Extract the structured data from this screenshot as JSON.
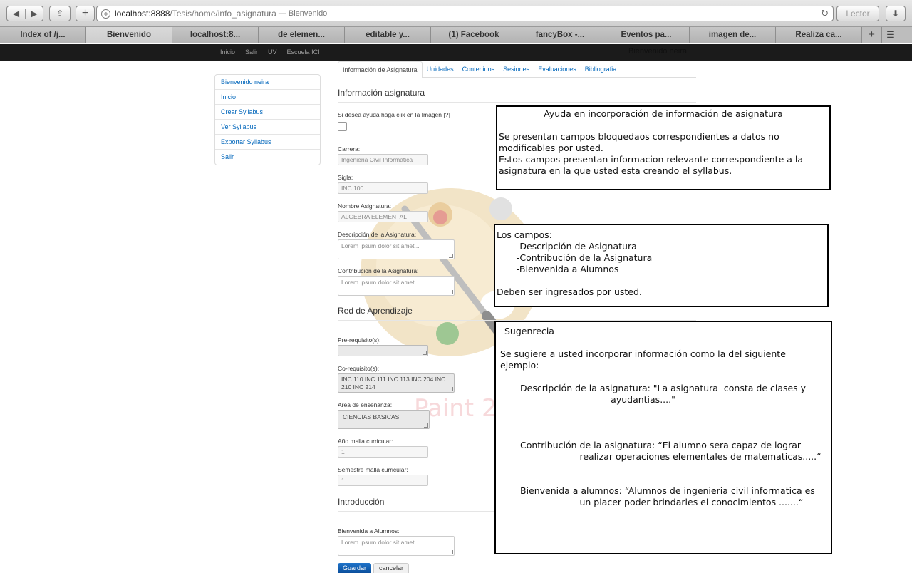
{
  "browser": {
    "url_host": "localhost:8888",
    "url_path": "/Tesis/home/info_asignatura",
    "page_title_sep": "— Bienvenido",
    "reader_label": "Lector",
    "tabs": [
      {
        "label": "Index of /j..."
      },
      {
        "label": "Bienvenido"
      },
      {
        "label": "localhost:8..."
      },
      {
        "label": "de elemen..."
      },
      {
        "label": "editable y..."
      },
      {
        "label": "(1) Facebook"
      },
      {
        "label": "fancyBox -..."
      },
      {
        "label": "Eventos pa..."
      },
      {
        "label": "imagen de..."
      },
      {
        "label": "Realiza ca..."
      }
    ]
  },
  "navbar": {
    "links": [
      "Inicio",
      "Salir",
      "UV",
      "Escuela ICI"
    ],
    "welcome": "Bienvenido neira"
  },
  "sidebar": {
    "items": [
      {
        "label": "Bienvenido neira"
      },
      {
        "label": "Inicio"
      },
      {
        "label": "Crear Syllabus"
      },
      {
        "label": "Ver Syllabus"
      },
      {
        "label": "Exportar Syllabus"
      },
      {
        "label": "Salir"
      }
    ]
  },
  "main": {
    "tabs": [
      {
        "label": "Información de Asignatura"
      },
      {
        "label": "Unidades"
      },
      {
        "label": "Contenidos"
      },
      {
        "label": "Sesiones"
      },
      {
        "label": "Evaluaciones"
      },
      {
        "label": "Bibliografia"
      }
    ],
    "info_title": "Información asignatura",
    "help_label": "Si desea ayuda haga clik en la Imagen [?]",
    "fields": {
      "carrera_label": "Carrera:",
      "carrera_value": "Ingenieria Civil Informatica",
      "sigla_label": "Sigla:",
      "sigla_value": "INC 100",
      "nombre_label": "Nombre Asignatura:",
      "nombre_value": "ALGEBRA ELEMENTAL",
      "descripcion_label": "Descripción de la Asignatura:",
      "descripcion_placeholder": "Lorem ipsum dolor sit amet...",
      "contribucion_label": "Contribucion de la Asignatura:",
      "contribucion_placeholder": "Lorem ipsum dolor sit amet..."
    },
    "red_title": "Red de Aprendizaje",
    "red": {
      "prereq_label": "Pre-requisito(s):",
      "prereq_value": "",
      "coreq_label": "Co-requisito(s):",
      "coreq_value": "INC 110 INC 111 INC 113 INC 204 INC 210 INC 214",
      "area_label": "Area de enseñanza:",
      "area_value": "CIENCIAS BASICAS",
      "anio_label": "Año malla curricular:",
      "anio_value": "1",
      "semestre_label": "Semestre malla curricular:",
      "semestre_value": "1"
    },
    "intro_title": "Introducción",
    "intro": {
      "bienvenida_label": "Bienvenida a Alumnos:",
      "bienvenida_placeholder": "Lorem ipsum dolor sit amet..."
    },
    "save_label": "Guardar",
    "cancel_label": "cancelar"
  },
  "watermark": {
    "text": "Paint 2"
  },
  "notes": {
    "note1_title": "Ayuda en incorporación de información de asignatura",
    "note1_body": "Se presentan campos bloquedaos correspondientes a datos no\nmodificables por usted.\nEstos campos presentan informacion relevante correspondiente a la\nasignatura en la que usted esta creando el syllabus.",
    "note2_body": "Los campos:\n       -Descripción de Asignatura\n       -Contribución de la Asignatura\n       -Bienvenida a Alumnos\n\nDeben ser ingresados por usted.",
    "note3_title": " Sugenrecia",
    "note3_intro": "Se sugiere a usted incorporar información como la del siguiente\nejemplo:",
    "note3_ex1": "Descripción de la asignatura: \"La asignatura  consta de clases y\n                                ayudantias....\"",
    "note3_ex2": "Contribución de la asignatura: “El alumno sera capaz de lograr\n                     realizar operaciones elementales de matematicas.....“",
    "note3_ex3": "Bienvenida a alumnos: “Alumnos de ingenieria civil informatica es\n                     un placer poder brindarles el conocimientos .......“"
  }
}
